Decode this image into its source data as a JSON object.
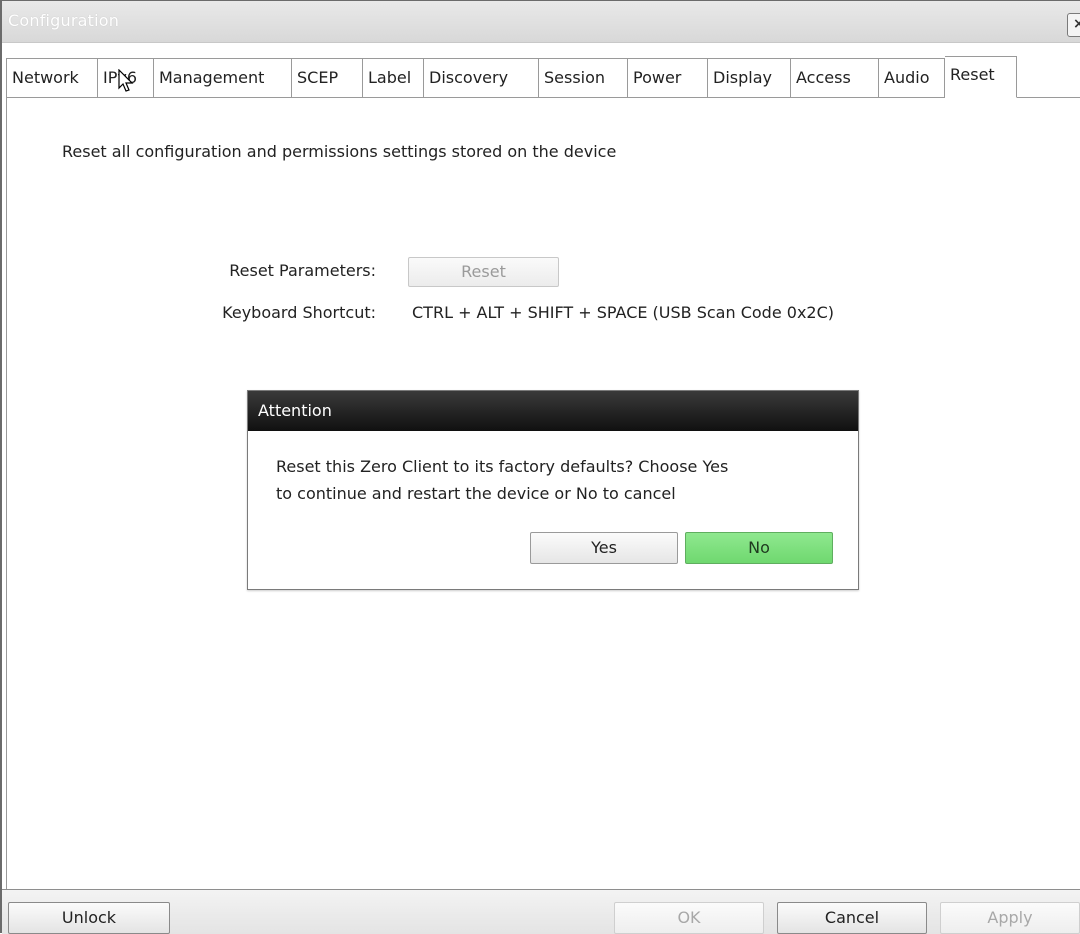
{
  "window": {
    "title": "Configuration",
    "close_glyph": "×"
  },
  "tabs": [
    {
      "label": "Network"
    },
    {
      "label": "IPv6"
    },
    {
      "label": "Management"
    },
    {
      "label": "SCEP"
    },
    {
      "label": "Label"
    },
    {
      "label": "Discovery"
    },
    {
      "label": "Session"
    },
    {
      "label": "Power"
    },
    {
      "label": "Display"
    },
    {
      "label": "Access"
    },
    {
      "label": "Audio"
    },
    {
      "label": "Reset",
      "active": true
    }
  ],
  "reset_panel": {
    "description": "Reset all configuration and permissions settings stored on the device",
    "reset_params_label": "Reset Parameters:",
    "reset_button_label": "Reset",
    "shortcut_label": "Keyboard Shortcut:",
    "shortcut_value": "CTRL + ALT + SHIFT + SPACE (USB Scan Code 0x2C)"
  },
  "dialog": {
    "title": "Attention",
    "message_line1": "Reset this Zero Client to its factory defaults? Choose Yes",
    "message_line2": "to continue and restart the device or No to cancel",
    "yes_label": "Yes",
    "no_label": "No"
  },
  "bottom_bar": {
    "unlock_label": "Unlock",
    "ok_label": "OK",
    "cancel_label": "Cancel",
    "apply_label": "Apply"
  },
  "icons": {
    "cursor": "mouse-pointer-icon",
    "close": "close-icon"
  },
  "colors": {
    "no_button": "#7ee07e",
    "dialog_title_bg": "#1c1c1c"
  }
}
